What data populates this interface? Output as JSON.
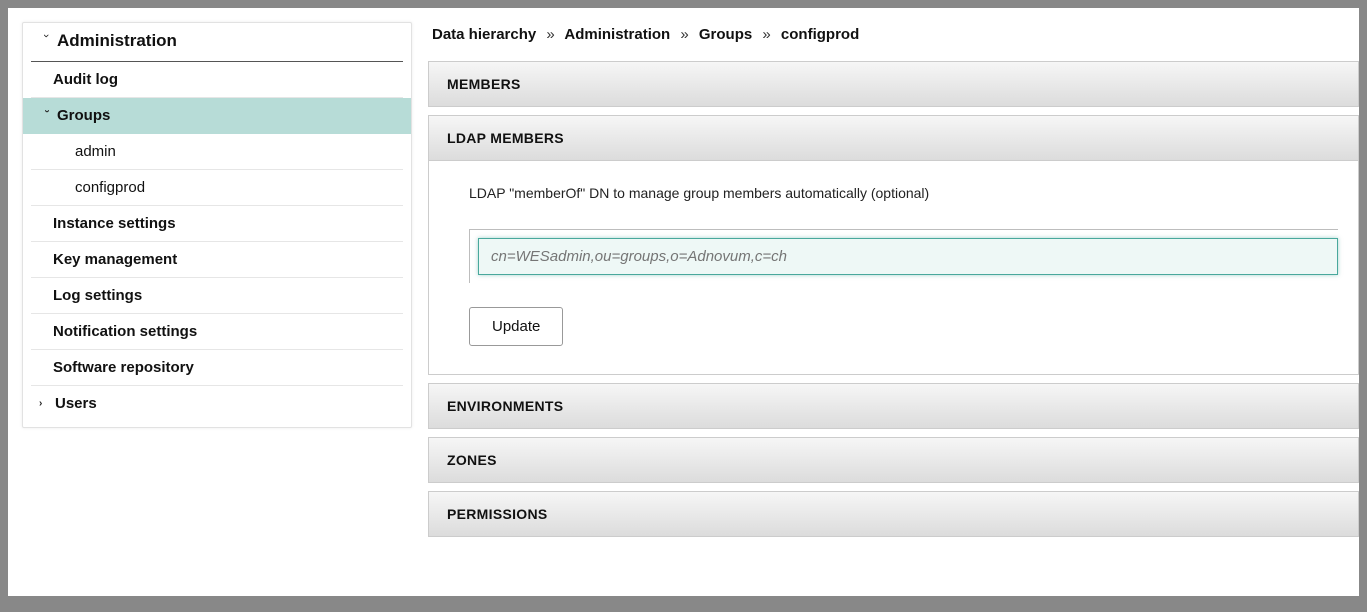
{
  "sidebar": {
    "header": "Administration",
    "items": [
      {
        "label": "Audit log"
      },
      {
        "label": "Groups"
      },
      {
        "label": "admin"
      },
      {
        "label": "configprod"
      },
      {
        "label": "Instance settings"
      },
      {
        "label": "Key management"
      },
      {
        "label": "Log settings"
      },
      {
        "label": "Notification settings"
      },
      {
        "label": "Software repository"
      }
    ],
    "users": "Users"
  },
  "breadcrumb": {
    "parts": [
      "Data hierarchy",
      "Administration",
      "Groups",
      "configprod"
    ],
    "sep": "»"
  },
  "panels": {
    "members": "MEMBERS",
    "ldap": {
      "title": "LDAP MEMBERS",
      "desc": "LDAP \"memberOf\" DN to manage group members automatically (optional)",
      "placeholder": "cn=WESadmin,ou=groups,o=Adnovum,c=ch",
      "update": "Update"
    },
    "environments": "ENVIRONMENTS",
    "zones": "ZONES",
    "permissions": "PERMISSIONS"
  }
}
